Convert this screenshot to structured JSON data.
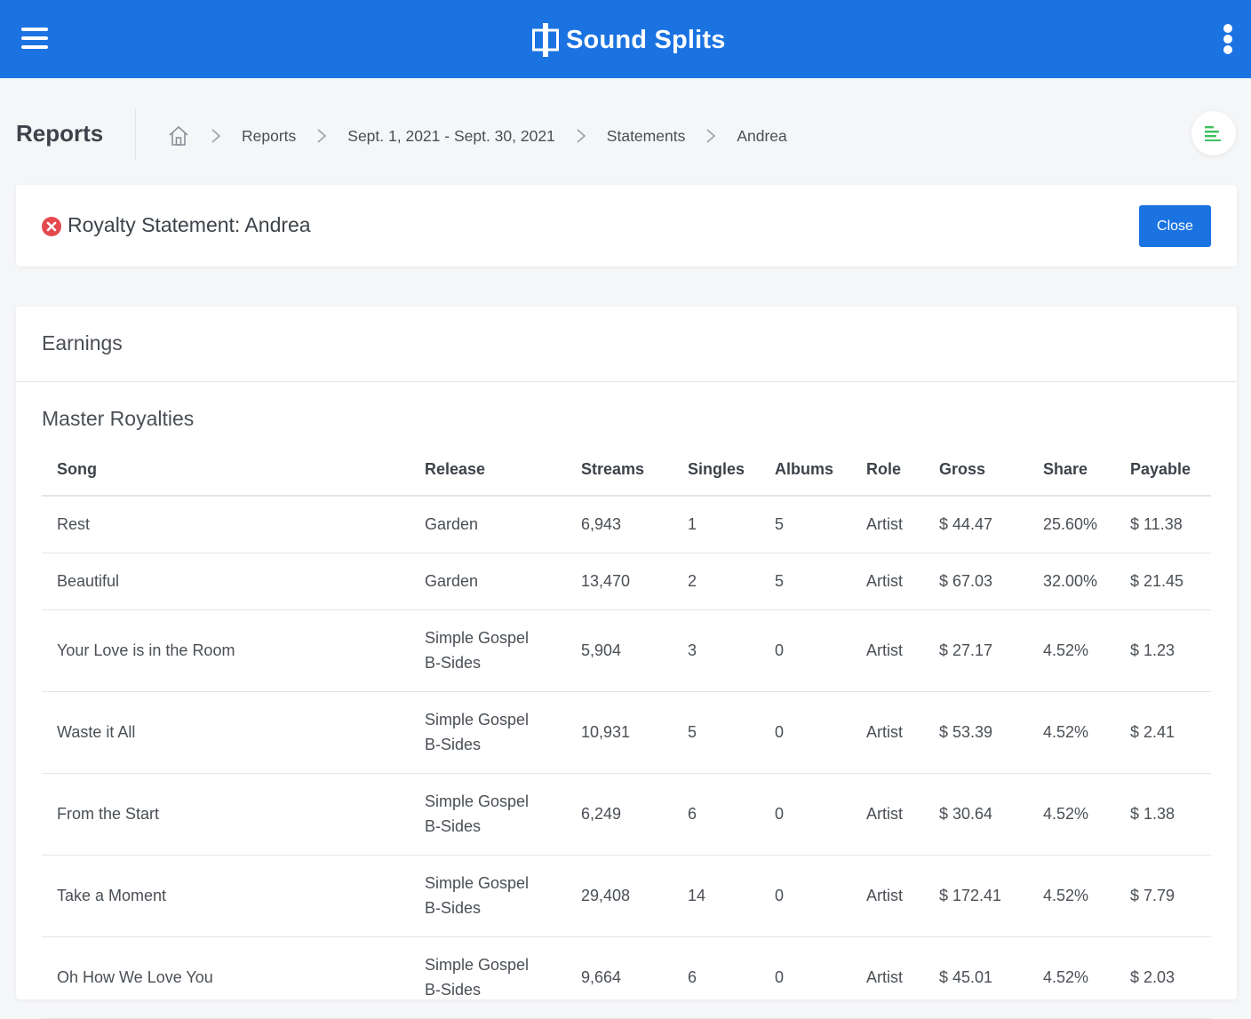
{
  "app": {
    "brand": "Sound Splits"
  },
  "page": {
    "title": "Reports"
  },
  "breadcrumb": [
    "Reports",
    "Sept. 1, 2021 - Sept. 30, 2021",
    "Statements",
    "Andrea"
  ],
  "statement": {
    "title": "Royalty Statement: Andrea",
    "close_label": "Close"
  },
  "earnings": {
    "title": "Earnings",
    "section": "Master Royalties",
    "columns": [
      "Song",
      "Release",
      "Streams",
      "Singles",
      "Albums",
      "Role",
      "Gross",
      "Share",
      "Payable"
    ],
    "rows": [
      [
        "Rest",
        "Garden",
        "6,943",
        "1",
        "5",
        "Artist",
        "$ 44.47",
        "25.60%",
        "$ 11.38"
      ],
      [
        "Beautiful",
        "Garden",
        "13,470",
        "2",
        "5",
        "Artist",
        "$ 67.03",
        "32.00%",
        "$ 21.45"
      ],
      [
        "Your Love is in the Room",
        "Simple Gospel B-Sides",
        "5,904",
        "3",
        "0",
        "Artist",
        "$ 27.17",
        "4.52%",
        "$ 1.23"
      ],
      [
        "Waste it All",
        "Simple Gospel B-Sides",
        "10,931",
        "5",
        "0",
        "Artist",
        "$ 53.39",
        "4.52%",
        "$ 2.41"
      ],
      [
        "From the Start",
        "Simple Gospel B-Sides",
        "6,249",
        "6",
        "0",
        "Artist",
        "$ 30.64",
        "4.52%",
        "$ 1.38"
      ],
      [
        "Take a Moment",
        "Simple Gospel B-Sides",
        "29,408",
        "14",
        "0",
        "Artist",
        "$ 172.41",
        "4.52%",
        "$ 7.79"
      ],
      [
        "Oh How We Love You",
        "Simple Gospel B-Sides",
        "9,664",
        "6",
        "0",
        "Artist",
        "$ 45.01",
        "4.52%",
        "$ 2.03"
      ]
    ]
  },
  "colors": {
    "primary": "#1b73e2",
    "error": "#e5484d",
    "accent_green": "#3fbf5f"
  }
}
